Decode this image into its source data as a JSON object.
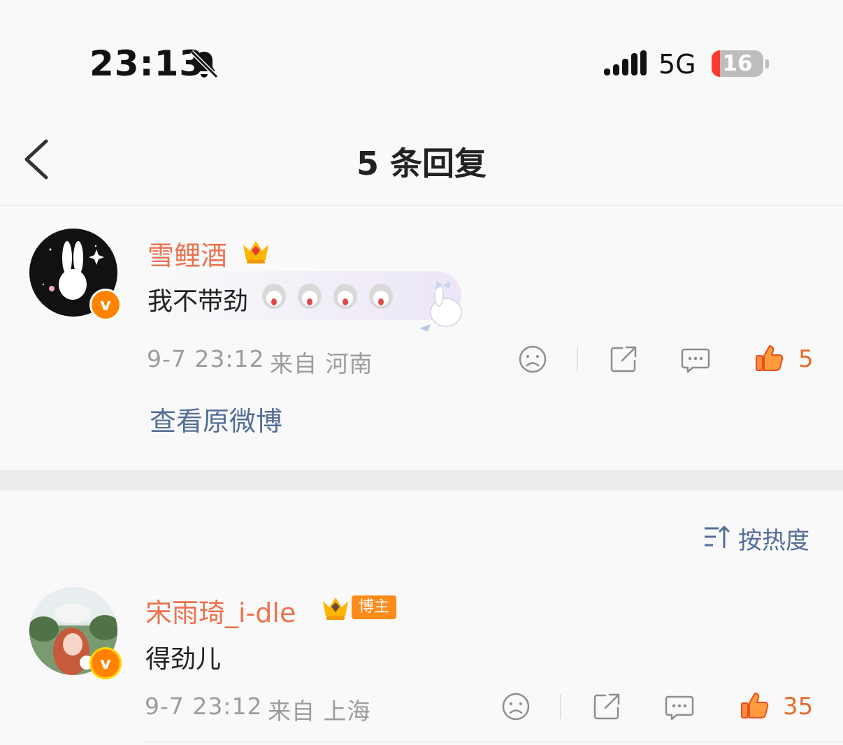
{
  "status_bar": {
    "time": "23:13",
    "network": "5G",
    "battery": "16",
    "battery_pct": 16
  },
  "header": {
    "title": "5 条回复"
  },
  "main_comment": {
    "username": "雪鲤酒",
    "text": "我不带劲",
    "emoji_count": 4,
    "timestamp": "9-7 23:12",
    "source": "来自 河南",
    "likes": "5",
    "view_original": "查看原微博"
  },
  "sort": {
    "label": "按热度"
  },
  "replies": [
    {
      "username": "宋雨琦_i-dle",
      "badge": "博主",
      "text": "得劲儿",
      "timestamp": "9-7 23:12",
      "source": "来自 上海",
      "likes": "35"
    }
  ],
  "colors": {
    "accent": "#eb7350",
    "link": "#536d97",
    "like": "#e86b2b",
    "meta": "#9c9c9c"
  }
}
